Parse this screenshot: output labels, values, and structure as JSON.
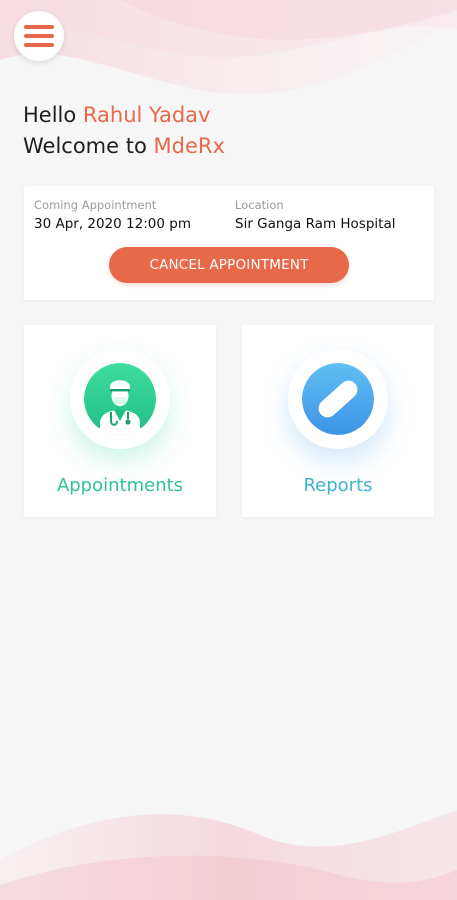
{
  "header": {
    "menu_icon": "hamburger-menu-icon"
  },
  "greeting": {
    "hello": "Hello",
    "user_name": "Rahul Yadav",
    "welcome": "Welcome to",
    "app_name": "MdeRx"
  },
  "appointment_card": {
    "coming_label": "Coming Appointment",
    "coming_value": "30 Apr, 2020 12:00 pm",
    "location_label": "Location",
    "location_value": "Sir Ganga Ram Hospital",
    "cancel_button": "CANCEL APPOINTMENT"
  },
  "tiles": [
    {
      "label": "Appointments",
      "icon": "doctor-icon"
    },
    {
      "label": "Reports",
      "icon": "pill-icon"
    }
  ],
  "colors": {
    "accent": "#e8684a",
    "appointments_green": "#2fc29a",
    "reports_blue": "#3fb2cf",
    "background": "#f6f6f6"
  }
}
